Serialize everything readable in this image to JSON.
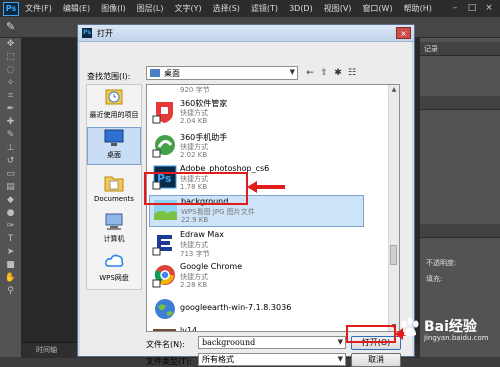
{
  "photoshop": {
    "logo": "Ps",
    "menu": [
      "文件(F)",
      "编辑(E)",
      "图像(I)",
      "图层(L)",
      "文字(Y)",
      "选择(S)",
      "滤镜(T)",
      "3D(D)",
      "视图(V)",
      "窗口(W)",
      "帮助(H)"
    ],
    "window_controls": [
      "–",
      "□",
      "×"
    ],
    "right_panel": {
      "tab1": "记录",
      "row_opacity": "不透明度:",
      "row_fill": "填充:"
    },
    "status_text": "时间轴"
  },
  "dialog": {
    "title": "打开",
    "close_label": "×",
    "lookin_label": "查找范围(I):",
    "lookin_value": "桌面",
    "places": [
      {
        "label": "最近使用的项目",
        "icon": "recent-icon"
      },
      {
        "label": "桌面",
        "icon": "desktop-icon"
      },
      {
        "label": "Documents",
        "icon": "documents-icon"
      },
      {
        "label": "计算机",
        "icon": "computer-icon"
      },
      {
        "label": "WPS网盘",
        "icon": "cloud-icon"
      }
    ],
    "files": [
      {
        "name": "",
        "type": "",
        "size": "920 字节"
      },
      {
        "name": "360软件管家",
        "type": "快捷方式",
        "size": "2.04 KB"
      },
      {
        "name": "360手机助手",
        "type": "快捷方式",
        "size": "2.02 KB"
      },
      {
        "name": "Adobe_photoshop_cs6",
        "type": "快捷方式",
        "size": "1.78 KB"
      },
      {
        "name": "background",
        "type": "WPS看图 JPG 图片文件",
        "size": "22.9 KB"
      },
      {
        "name": "Edraw Max",
        "type": "快捷方式",
        "size": "713 字节"
      },
      {
        "name": "Google Chrome",
        "type": "快捷方式",
        "size": "2.28 KB"
      },
      {
        "name": "googleearth-win-7.1.8.3036",
        "type": "",
        "size": ""
      },
      {
        "name": "lv14",
        "type": "WPS看图 JPG 图片文件",
        "size": ""
      }
    ],
    "filename_label": "文件名(N):",
    "filename_value": "backgroound",
    "filetype_label": "文件类型(T):",
    "filetype_value": "所有格式",
    "open_button": "打开(O)",
    "cancel_button": "取消"
  },
  "watermark": {
    "brand": "Bai经验",
    "url": "jingyan.baidu.com"
  },
  "colors": {
    "highlight_red": "#e21b1b",
    "selection_blue": "#cde3f8"
  }
}
